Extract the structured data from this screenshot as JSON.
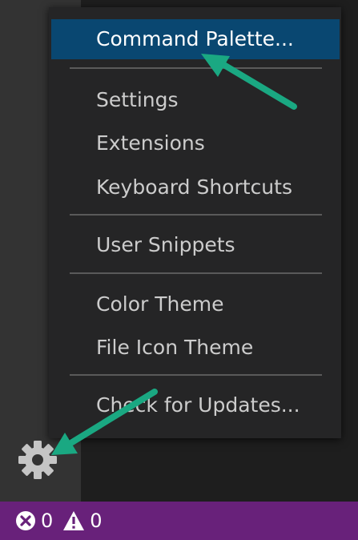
{
  "menu": {
    "items": [
      {
        "label": "Command Palette...",
        "selected": true
      },
      {
        "label": "Settings"
      },
      {
        "label": "Extensions"
      },
      {
        "label": "Keyboard Shortcuts"
      },
      {
        "label": "User Snippets"
      },
      {
        "label": "Color Theme"
      },
      {
        "label": "File Icon Theme"
      },
      {
        "label": "Check for Updates..."
      }
    ]
  },
  "activity_bar": {
    "manage_icon": "gear-icon"
  },
  "status_bar": {
    "errors": "0",
    "warnings": "0",
    "error_icon": "error-circle-icon",
    "warning_icon": "warning-triangle-icon"
  },
  "colors": {
    "menu_background": "#252526",
    "menu_selected": "#094771",
    "status_bar": "#68217a",
    "annotation_arrow": "#1aa882"
  }
}
